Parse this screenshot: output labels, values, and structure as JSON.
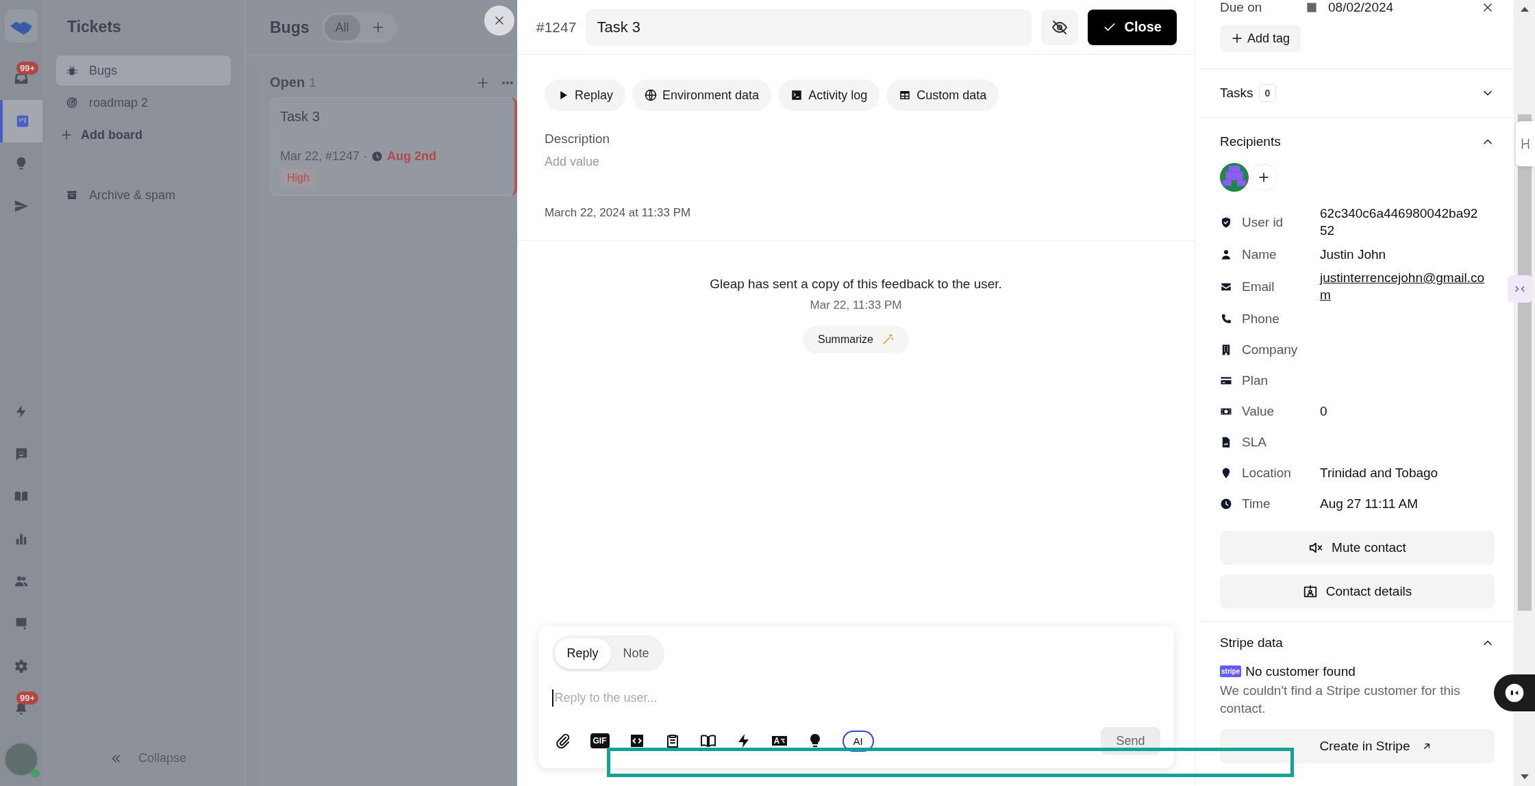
{
  "rail": {
    "items": [
      {
        "kind": "inbox",
        "selected": false,
        "badge": "99+"
      },
      {
        "kind": "board",
        "selected": true
      },
      {
        "kind": "bulb",
        "selected": false
      },
      {
        "kind": "send",
        "selected": false
      }
    ],
    "bottom_items": [
      {
        "kind": "bolt",
        "selected": false
      },
      {
        "kind": "smile",
        "selected": false
      },
      {
        "kind": "book",
        "selected": false
      },
      {
        "kind": "chart",
        "selected": false
      },
      {
        "kind": "people",
        "selected": false
      },
      {
        "kind": "chat",
        "selected": false
      },
      {
        "kind": "gear",
        "selected": false
      },
      {
        "kind": "bell",
        "selected": false,
        "badge": "99+"
      }
    ],
    "user": {
      "online": true
    }
  },
  "sidebar": {
    "title": "Tickets",
    "items": [
      {
        "kind": "bug",
        "label": "Bugs",
        "selected": true
      },
      {
        "kind": "target",
        "label": "roadmap 2",
        "selected": false
      }
    ],
    "add_board": "Add board",
    "archive": "Archive & spam",
    "collapse": "Collapse"
  },
  "board": {
    "title": "Bugs",
    "filters": [
      {
        "label": "All",
        "selected": true
      }
    ],
    "columns": [
      {
        "name": "Open",
        "count": "1",
        "cards": [
          {
            "title": "Task 3",
            "meta": "Mar 22, #1247 ·",
            "due": "Aug 2nd",
            "priority": "High"
          }
        ]
      }
    ]
  },
  "ticket": {
    "number": "#1247",
    "title": "Task 3",
    "close": "Close",
    "actions": [
      {
        "kind": "play",
        "label": "Replay"
      },
      {
        "kind": "globe",
        "label": "Environment data"
      },
      {
        "kind": "terminal",
        "label": "Activity log"
      },
      {
        "kind": "table",
        "label": "Custom data"
      }
    ],
    "description_label": "Description",
    "description_placeholder": "Add value",
    "created": "March 22, 2024 at 11:33 PM",
    "events": [
      {
        "text": "Gleap has sent a copy of this feedback to the user.",
        "time": "Mar 22, 11:33 PM"
      }
    ],
    "summarize": "Summarize"
  },
  "composer": {
    "tabs": [
      {
        "label": "Reply",
        "selected": true
      },
      {
        "label": "Note",
        "selected": false
      }
    ],
    "placeholder": "Reply to the user...",
    "tools": [
      {
        "kind": "attach"
      },
      {
        "kind": "gif",
        "label": "GIF"
      },
      {
        "kind": "code"
      },
      {
        "kind": "clipboard"
      },
      {
        "kind": "bookline"
      },
      {
        "kind": "bolt"
      },
      {
        "kind": "translate"
      },
      {
        "kind": "bulb"
      },
      {
        "kind": "ai",
        "label": "AI"
      }
    ],
    "send": "Send",
    "send_disabled": true
  },
  "details": {
    "due_label": "Due on",
    "due_value": "08/02/2024",
    "add_tag": "Add tag",
    "tasks": {
      "title": "Tasks",
      "count": "0",
      "expanded": false
    },
    "recipients": {
      "title": "Recipients",
      "expanded": true,
      "attributes": [
        {
          "kind": "shield",
          "label": "User id",
          "value": "62c340c6a446980042ba9252"
        },
        {
          "kind": "person",
          "label": "Name",
          "value": "Justin John"
        },
        {
          "kind": "mail",
          "label": "Email",
          "value": "justinterrencejohn@gmail.com",
          "link": true
        },
        {
          "kind": "phone",
          "label": "Phone"
        },
        {
          "kind": "building",
          "label": "Company"
        },
        {
          "kind": "card",
          "label": "Plan"
        },
        {
          "kind": "money",
          "label": "Value",
          "value": "0"
        },
        {
          "kind": "file",
          "label": "SLA"
        },
        {
          "kind": "pin",
          "label": "Location",
          "value": "Trinidad and Tobago"
        },
        {
          "kind": "clock",
          "label": "Time",
          "value": "Aug 27 11:11 AM"
        }
      ],
      "buttons": [
        {
          "kind": "mute",
          "label": "Mute contact"
        },
        {
          "kind": "contact",
          "label": "Contact details"
        }
      ]
    },
    "stripe": {
      "title": "Stripe data",
      "expanded": true,
      "logo_text": "stripe",
      "status": "No customer found",
      "message": "We couldn't find a Stripe customer for this contact.",
      "button": "Create in Stripe"
    }
  }
}
